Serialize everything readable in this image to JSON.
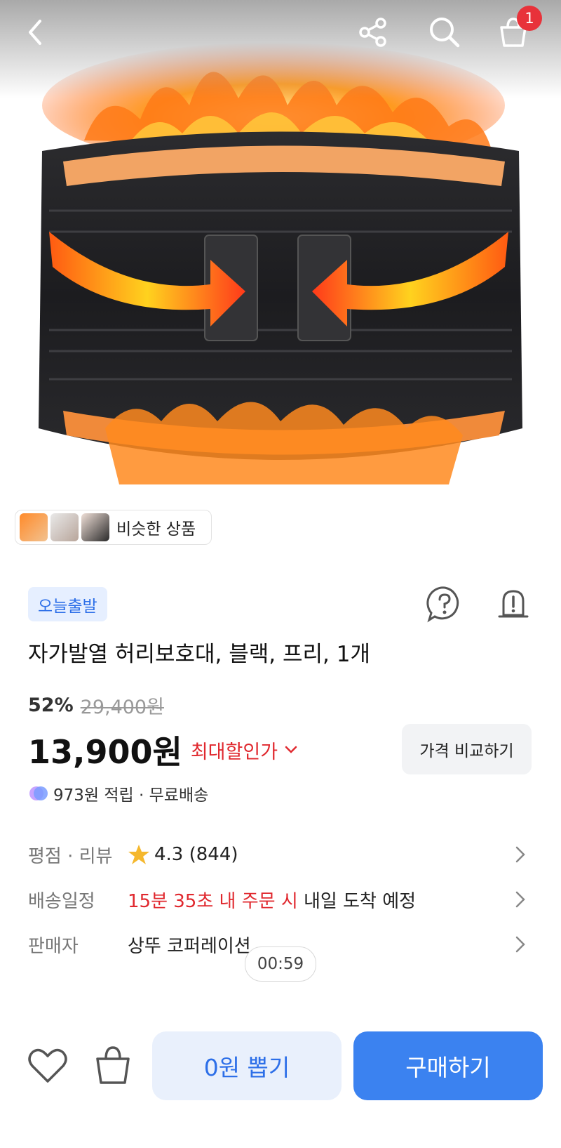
{
  "header": {
    "cart_count": "1"
  },
  "similar": {
    "label": "비슷한 상품"
  },
  "product": {
    "badge": "오늘출발",
    "title": "자가발열 허리보호대, 블랙, 프리, 1개",
    "discount_pct": "52%",
    "original_price": "29,400원",
    "price": "13,900원",
    "max_discount_label": "최대할인가",
    "compare_label": "가격 비교하기",
    "points": "973원 적립 · 무료배송"
  },
  "info": {
    "rating_label": "평점 · 리뷰",
    "rating_value": "4.3 (844)",
    "shipping_label": "배송일정",
    "shipping_countdown": "15분 35초 내 주문 시",
    "shipping_eta": " 내일 도착 예정",
    "seller_label": "판매자",
    "seller_name": "상뚜 코퍼레이션"
  },
  "timer": "00:59",
  "bottom": {
    "zero_won_label": "0원 뽑기",
    "buy_label": "구매하기"
  },
  "colors": {
    "accent_blue": "#3b82f0",
    "sale_red": "#e0282e",
    "star": "#f5b82e"
  }
}
